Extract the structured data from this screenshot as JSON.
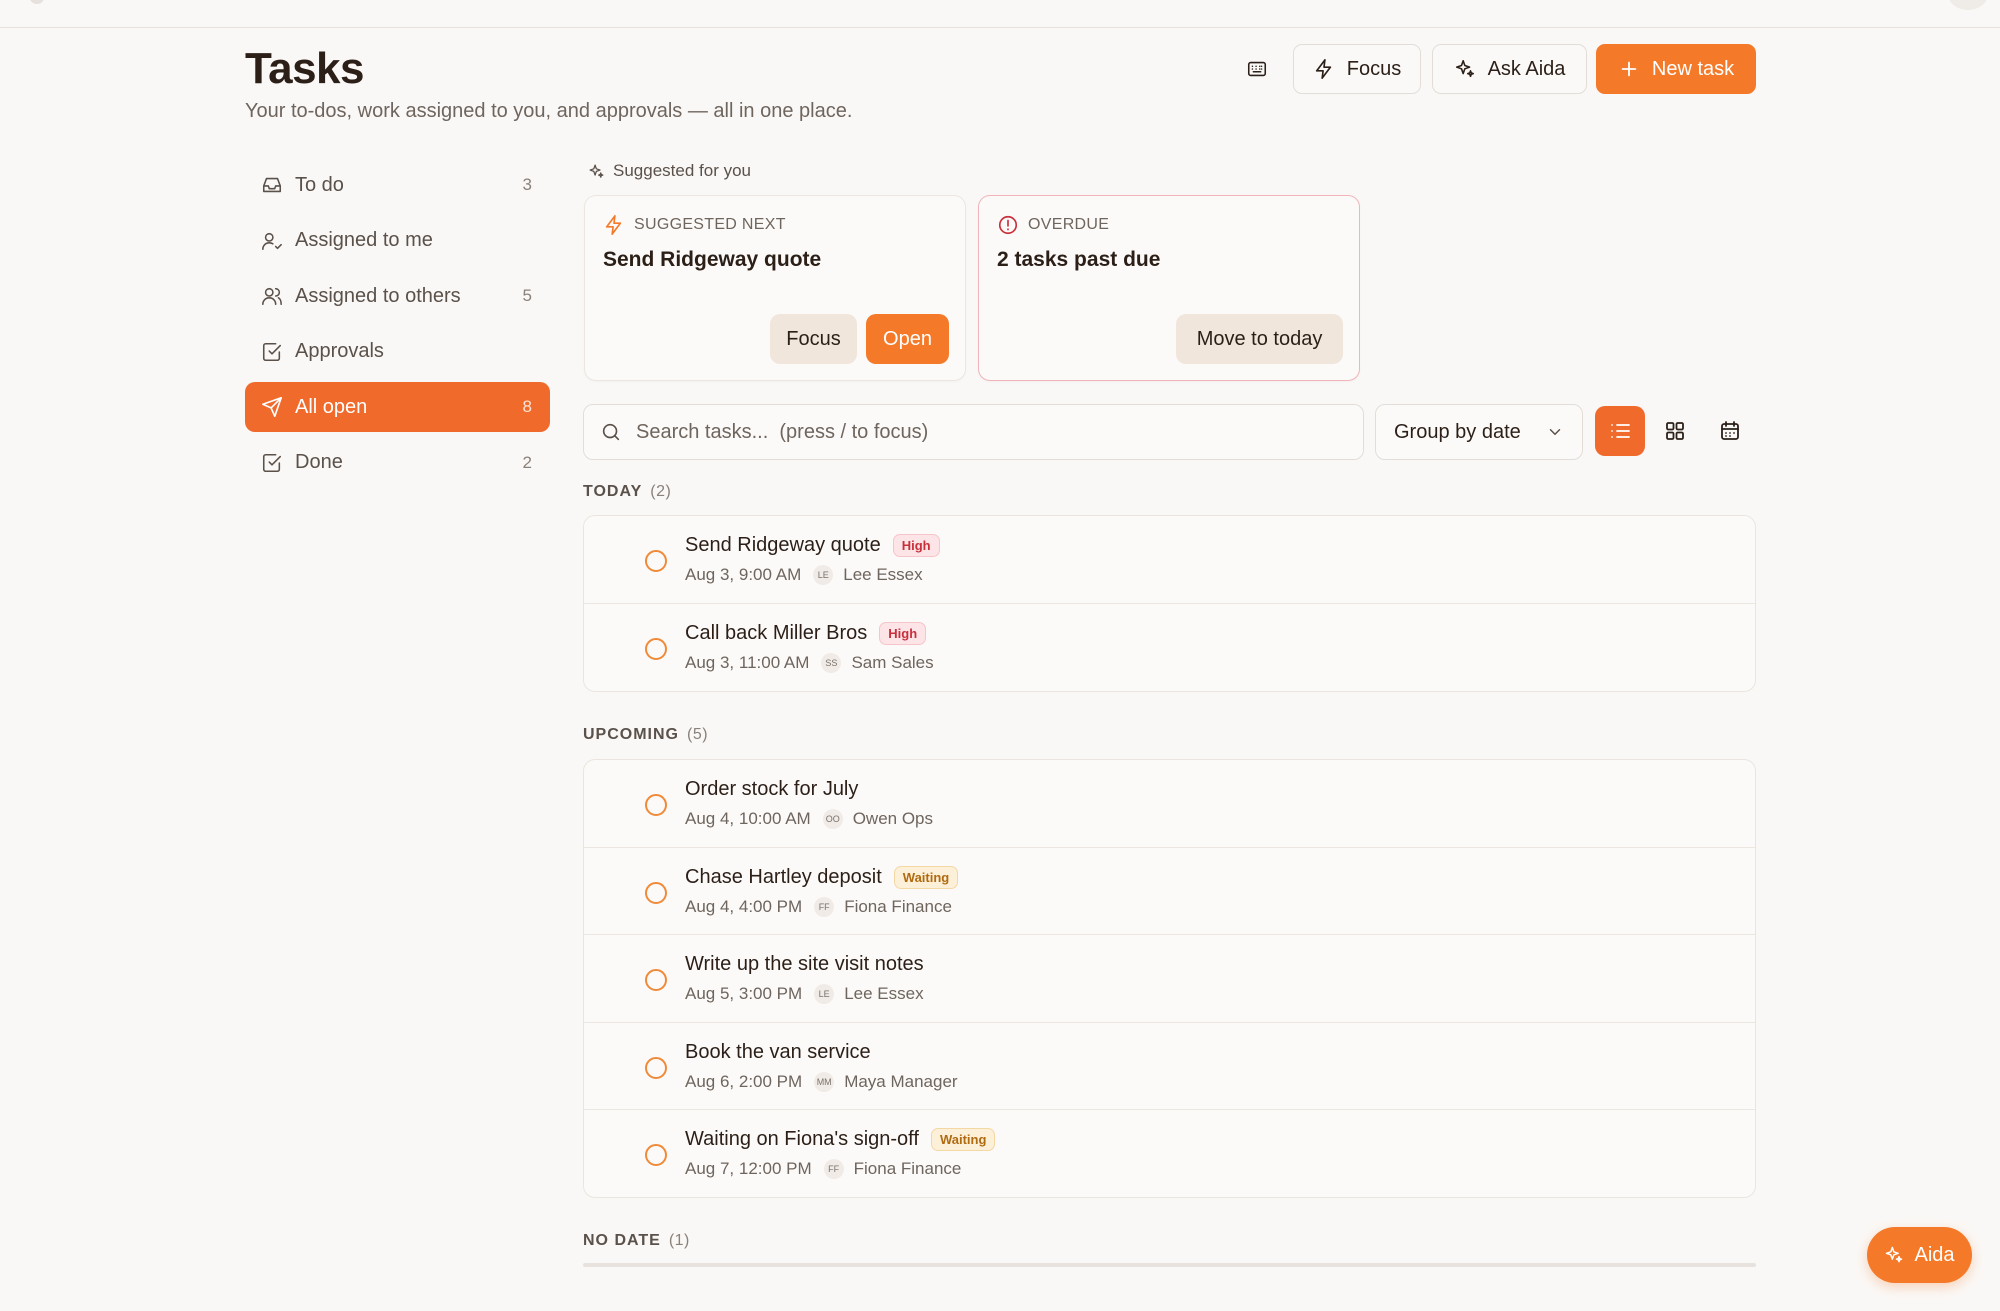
{
  "page": {
    "title": "Tasks",
    "subtitle": "Your to-dos, work assigned to you, and approvals — all in one place."
  },
  "header": {
    "focus_label": "Focus",
    "ask_label": "Ask Aida",
    "new_label": "New task"
  },
  "sidebar": {
    "items": [
      {
        "label": "To do",
        "count": "3",
        "icon": "inbox-icon"
      },
      {
        "label": "Assigned to me",
        "count": "",
        "icon": "user-check-icon"
      },
      {
        "label": "Assigned to others",
        "count": "5",
        "icon": "users-icon"
      },
      {
        "label": "Approvals",
        "count": "",
        "icon": "check-square-icon"
      },
      {
        "label": "All open",
        "count": "8",
        "icon": "send-icon",
        "active": true
      },
      {
        "label": "Done",
        "count": "2",
        "icon": "check-square-icon"
      }
    ]
  },
  "suggested": {
    "heading": "Suggested for you",
    "next": {
      "kicker": "SUGGESTED NEXT",
      "title": "Send Ridgeway quote",
      "focus_label": "Focus",
      "open_label": "Open"
    },
    "overdue": {
      "kicker": "OVERDUE",
      "title": "2 tasks past due",
      "action_label": "Move to today"
    }
  },
  "toolbar": {
    "search_placeholder": "Search tasks...  (press / to focus)",
    "group_label": "Group by date",
    "view_active": "list"
  },
  "sections": {
    "today": {
      "label": "TODAY",
      "count": "(2)",
      "tasks": [
        {
          "title": "Send Ridgeway quote",
          "badge": "High",
          "badge_type": "high",
          "when": "Aug 3, 9:00 AM",
          "initials": "LE",
          "person": "Lee Essex"
        },
        {
          "title": "Call back Miller Bros",
          "badge": "High",
          "badge_type": "high",
          "when": "Aug 3, 11:00 AM",
          "initials": "SS",
          "person": "Sam Sales"
        }
      ]
    },
    "upcoming": {
      "label": "UPCOMING",
      "count": "(5)",
      "tasks": [
        {
          "title": "Order stock for July",
          "badge": "",
          "badge_type": "",
          "when": "Aug 4, 10:00 AM",
          "initials": "OO",
          "person": "Owen Ops"
        },
        {
          "title": "Chase Hartley deposit",
          "badge": "Waiting",
          "badge_type": "waiting",
          "when": "Aug 4, 4:00 PM",
          "initials": "FF",
          "person": "Fiona Finance"
        },
        {
          "title": "Write up the site visit notes",
          "badge": "",
          "badge_type": "",
          "when": "Aug 5, 3:00 PM",
          "initials": "LE",
          "person": "Lee Essex"
        },
        {
          "title": "Book the van service",
          "badge": "",
          "badge_type": "",
          "when": "Aug 6, 2:00 PM",
          "initials": "MM",
          "person": "Maya Manager"
        },
        {
          "title": "Waiting on Fiona's sign-off",
          "badge": "Waiting",
          "badge_type": "waiting",
          "when": "Aug 7, 12:00 PM",
          "initials": "FF",
          "person": "Fiona Finance"
        }
      ]
    },
    "nodate": {
      "label": "NO DATE",
      "count": "(1)"
    }
  },
  "fab": {
    "label": "Aida"
  },
  "colors": {
    "accent": "#f47a2a",
    "active_nav": "#f06a2c",
    "background": "#faf8f6",
    "high_badge": "#c9303c",
    "waiting_badge": "#b06a10",
    "overdue_border": "#f0b4b9"
  }
}
